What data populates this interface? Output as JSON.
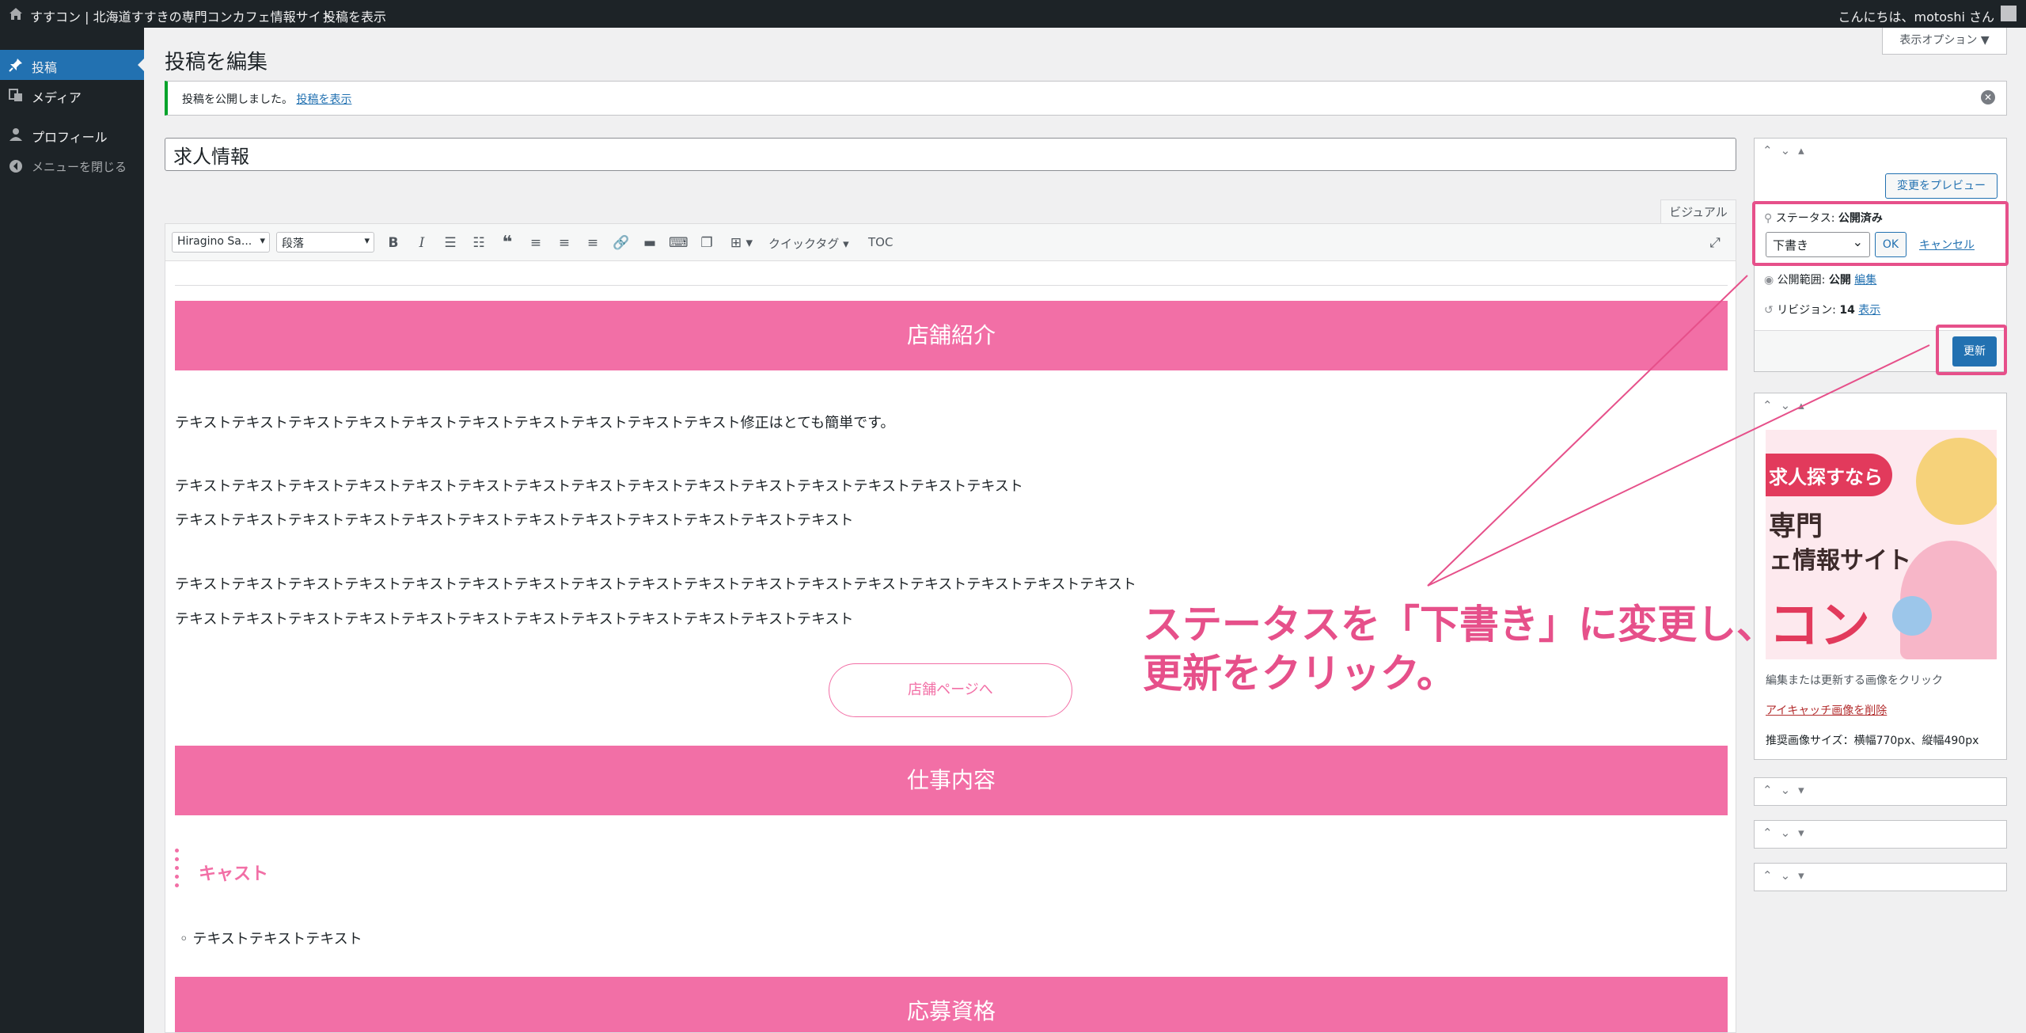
{
  "adminbar": {
    "site_name": "すすコン | 北海道すすきの専門コンカフェ情報サイト",
    "view_post": "投稿を表示",
    "greeting": "こんにちは、motoshi さん"
  },
  "sidebar": {
    "items": [
      {
        "label": "投稿",
        "icon": "pin-icon"
      },
      {
        "label": "メディア",
        "icon": "media-icon"
      },
      {
        "label": "プロフィール",
        "icon": "user-icon"
      },
      {
        "label": "メニューを閉じる",
        "icon": "collapse-icon"
      }
    ]
  },
  "header": {
    "title": "投稿を編集",
    "screen_options": "表示オプション ▼"
  },
  "notice": {
    "message": "投稿を公開しました。",
    "link": "投稿を表示"
  },
  "post": {
    "title": "求人情報"
  },
  "editor": {
    "visual_tab": "ビジュアル",
    "font_select": "Hiragino Sa...",
    "format_select": "段落",
    "quicktag": "クイックタグ ▾",
    "toc": "TOC",
    "heading1": "店舗紹介",
    "para1": "テキストテキストテキストテキストテキストテキストテキストテキストテキストテキスト修正はとても簡単です。",
    "para2a": "テキストテキストテキストテキストテキストテキストテキストテキストテキストテキストテキストテキストテキストテキストテキスト",
    "para2b": "テキストテキストテキストテキストテキストテキストテキストテキストテキストテキストテキストテキスト",
    "para3a": "テキストテキストテキストテキストテキストテキストテキストテキストテキストテキストテキストテキストテキストテキストテキストテキストテキスト",
    "para3b": "テキストテキストテキストテキストテキストテキストテキストテキストテキストテキストテキストテキスト",
    "shop_button": "店舗ページへ",
    "heading2": "仕事内容",
    "cast_heading": "キャスト",
    "list_item": "◦ テキストテキストテキスト",
    "heading3": "応募資格"
  },
  "publish": {
    "preview": "変更をプレビュー",
    "status_label": "ステータス:",
    "status_value": "公開済み",
    "status_select": "下書き",
    "ok": "OK",
    "cancel": "キャンセル",
    "visibility_label": "公開範囲:",
    "visibility_value": "公開",
    "visibility_edit": "編集",
    "revision_label": "リビジョン:",
    "revision_value": "14",
    "revision_view": "表示",
    "update": "更新"
  },
  "featured": {
    "image_text1": "求人探すなら",
    "image_text2": "専門",
    "image_text3": "ェ情報サイト",
    "image_text4": "コン",
    "description": "編集または更新する画像をクリック",
    "remove": "アイキャッチ画像を削除",
    "size_hint": "推奨画像サイズ：横幅770px、縦幅490px"
  },
  "annotation": {
    "line1": "ステータスを「下書き」に変更し、",
    "line2": "更新をクリック。"
  },
  "colors": {
    "accent_pink": "#f26fa6",
    "annotation_pink": "#e6508a",
    "wp_blue": "#2271b1",
    "admin_dark": "#1d2327"
  }
}
